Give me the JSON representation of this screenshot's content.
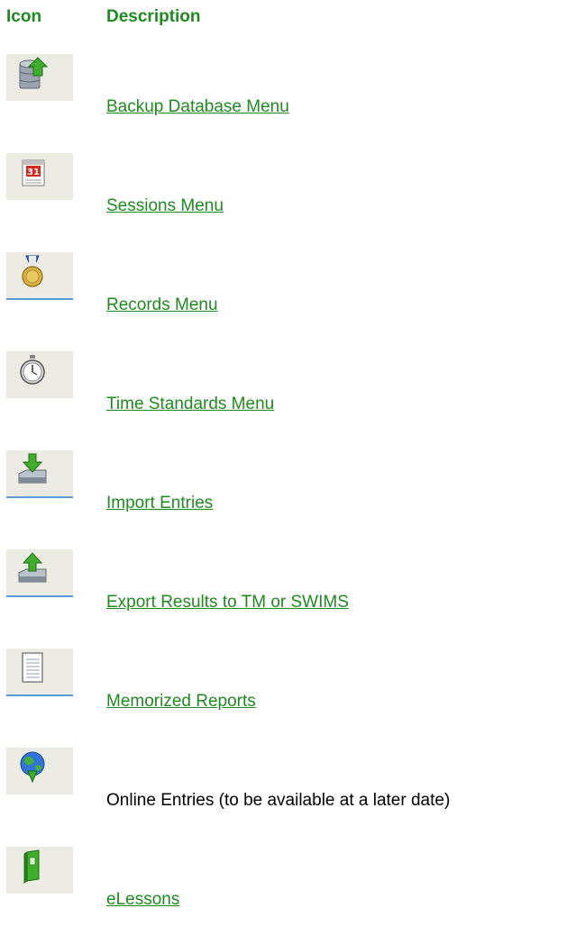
{
  "header": {
    "icon_label": "Icon",
    "description_label": "Description"
  },
  "colors": {
    "heading": "#1f8a1f",
    "link": "#1f8a1f",
    "tile": "#ecebe3",
    "tile_underline": "#5b9bd5"
  },
  "rows": [
    {
      "icon": "database-backup-icon",
      "label": "Backup Database Menu",
      "is_link": true
    },
    {
      "icon": "calendar-icon",
      "label": "Sessions Menu",
      "is_link": true
    },
    {
      "icon": "medal-icon",
      "label": "Records Menu",
      "is_link": true
    },
    {
      "icon": "stopwatch-icon",
      "label": "Time Standards Menu",
      "is_link": true
    },
    {
      "icon": "import-tray-icon",
      "label": "Import Entries",
      "is_link": true
    },
    {
      "icon": "export-tray-icon",
      "label": "Export Results to TM or SWIMS",
      "is_link": true
    },
    {
      "icon": "notepad-icon",
      "label": "Memorized Reports",
      "is_link": true
    },
    {
      "icon": "globe-download-icon",
      "label": "Online Entries (to be available at a later date)",
      "is_link": false
    },
    {
      "icon": "book-icon",
      "label": "eLessons",
      "is_link": true
    }
  ]
}
